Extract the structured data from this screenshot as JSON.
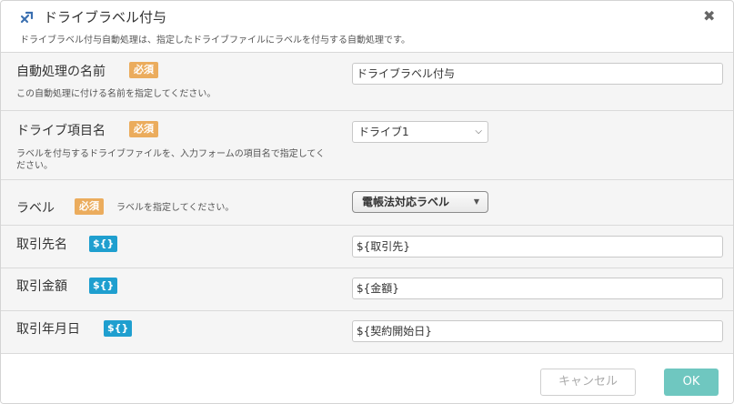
{
  "dialog": {
    "icon": "tag-icon",
    "title": "ドライブラベル付与",
    "subtitle": "ドライブラベル付与自動処理は、指定したドライブファイルにラベルを付与する自動処理です。",
    "close_glyph": "✖"
  },
  "fields": {
    "name": {
      "label": "自動処理の名前",
      "badge": "必須",
      "help": "この自動処理に付ける名前を指定してください。",
      "value": "ドライブラベル付与"
    },
    "drive_item": {
      "label": "ドライブ項目名",
      "badge": "必須",
      "help": "ラベルを付与するドライブファイルを、入力フォームの項目名で指定してください。",
      "selected": "ドライブ1"
    },
    "label": {
      "label": "ラベル",
      "badge": "必須",
      "help": "ラベルを指定してください。",
      "selected": "電帳法対応ラベル"
    },
    "partner": {
      "label": "取引先名",
      "badge": "${}",
      "value": "${取引先}"
    },
    "amount": {
      "label": "取引金額",
      "badge": "${}",
      "value": "${金額}"
    },
    "date": {
      "label": "取引年月日",
      "badge": "${}",
      "value": "${契約開始日}"
    }
  },
  "footer": {
    "cancel_label": "キャンセル",
    "ok_label": "OK"
  },
  "colors": {
    "required_badge": "#ebac5d",
    "variable_badge": "#1f9fcf",
    "ok_button": "#6fc7c0",
    "row_background": "#f5f5f5"
  }
}
